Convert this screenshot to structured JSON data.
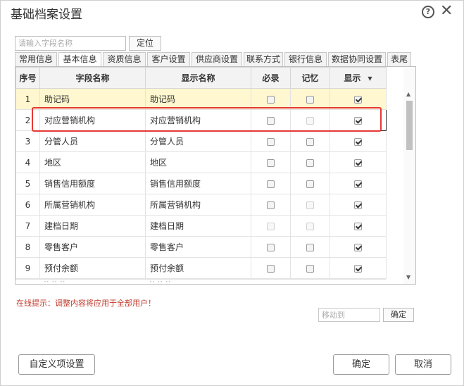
{
  "window": {
    "title": "基础档案设置",
    "help_icon": "?",
    "close_icon": "✕"
  },
  "search": {
    "placeholder": "请输入字段名称",
    "locate_label": "定位"
  },
  "tabs": [
    {
      "label": "常用信息",
      "active": false
    },
    {
      "label": "基本信息",
      "active": true
    },
    {
      "label": "资质信息",
      "active": false
    },
    {
      "label": "客户设置",
      "active": false
    },
    {
      "label": "供应商设置",
      "active": false
    },
    {
      "label": "联系方式",
      "active": false
    },
    {
      "label": "银行信息",
      "active": false
    },
    {
      "label": "数据协同设置",
      "active": false
    },
    {
      "label": "表尾",
      "active": false
    }
  ],
  "grid": {
    "columns": [
      "序号",
      "字段名称",
      "显示名称",
      "必录",
      "记忆",
      "显示"
    ],
    "rows": [
      {
        "no": "1",
        "field": "助记码",
        "display": "助记码",
        "required": false,
        "required_enabled": true,
        "memory": false,
        "memory_enabled": true,
        "show": true
      },
      {
        "no": "2",
        "field": "对应营销机构",
        "display": "对应营销机构",
        "required": false,
        "required_enabled": true,
        "memory": false,
        "memory_enabled": false,
        "show": true
      },
      {
        "no": "3",
        "field": "分管人员",
        "display": "分管人员",
        "required": false,
        "required_enabled": true,
        "memory": false,
        "memory_enabled": true,
        "show": true
      },
      {
        "no": "4",
        "field": "地区",
        "display": "地区",
        "required": false,
        "required_enabled": true,
        "memory": false,
        "memory_enabled": true,
        "show": true
      },
      {
        "no": "5",
        "field": "销售信用额度",
        "display": "销售信用额度",
        "required": false,
        "required_enabled": true,
        "memory": false,
        "memory_enabled": true,
        "show": true
      },
      {
        "no": "6",
        "field": "所属营销机构",
        "display": "所属营销机构",
        "required": false,
        "required_enabled": true,
        "memory": false,
        "memory_enabled": false,
        "show": true
      },
      {
        "no": "7",
        "field": "建档日期",
        "display": "建档日期",
        "required": false,
        "required_enabled": false,
        "memory": false,
        "memory_enabled": false,
        "show": true
      },
      {
        "no": "8",
        "field": "零售客户",
        "display": "零售客户",
        "required": false,
        "required_enabled": true,
        "memory": false,
        "memory_enabled": true,
        "show": true
      },
      {
        "no": "9",
        "field": "预付余额",
        "display": "预付余额",
        "required": false,
        "required_enabled": true,
        "memory": false,
        "memory_enabled": true,
        "show": true
      }
    ]
  },
  "hint": "在线提示：调整内容将应用于全部用户！",
  "move": {
    "placeholder": "移动到",
    "confirm_label": "确定"
  },
  "footer": {
    "custom_label": "自定义项设置",
    "ok_label": "确定",
    "cancel_label": "取消"
  },
  "colors": {
    "highlight_row": "#fff7cf",
    "selection_border": "#e53935",
    "hint_text": "#c0392b"
  }
}
